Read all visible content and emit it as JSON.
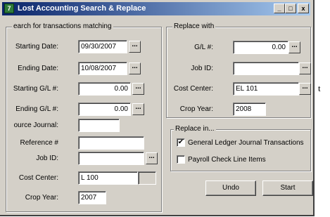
{
  "background_text": "t",
  "window": {
    "title": "Lost Accounting Search & Replace",
    "controls": {
      "minimize": "_",
      "maximize": "□",
      "close": "x"
    }
  },
  "search_group": {
    "legend": "earch for transactions matching",
    "starting_date": {
      "label": "Starting Date:",
      "value": "09/30/2007"
    },
    "ending_date": {
      "label": "Ending Date:",
      "value": "10/08/2007"
    },
    "starting_gl": {
      "label": "Starting G/L #:",
      "value": "0.00"
    },
    "ending_gl": {
      "label": "Ending G/L #:",
      "value": "0.00"
    },
    "source_journal": {
      "label": "ource Journal:",
      "value": ""
    },
    "reference": {
      "label": "Reference #",
      "value": ""
    },
    "job": {
      "label": "Job ID:",
      "value": ""
    },
    "cost_center": {
      "label": "Cost Center:",
      "value": "L 100"
    },
    "crop_year": {
      "label": "Crop Year:",
      "value": "2007"
    }
  },
  "replace_with_group": {
    "legend": "Replace with",
    "gl": {
      "label": "G/L #:",
      "value": "0.00"
    },
    "job": {
      "label": "Job ID:",
      "value": ""
    },
    "cost_center": {
      "label": "Cost Center:",
      "value": "EL 101"
    },
    "crop_year": {
      "label": "Crop Year:",
      "value": "2008"
    }
  },
  "replace_in_group": {
    "legend": "Replace in...",
    "options": [
      {
        "label": "General Ledger Journal Transactions",
        "checked": true,
        "mark": "✔"
      },
      {
        "label": "Payroll Check Line Items",
        "checked": false,
        "mark": ""
      }
    ]
  },
  "buttons": {
    "undo": "Undo",
    "start": "Start"
  },
  "ellipsis": "..."
}
